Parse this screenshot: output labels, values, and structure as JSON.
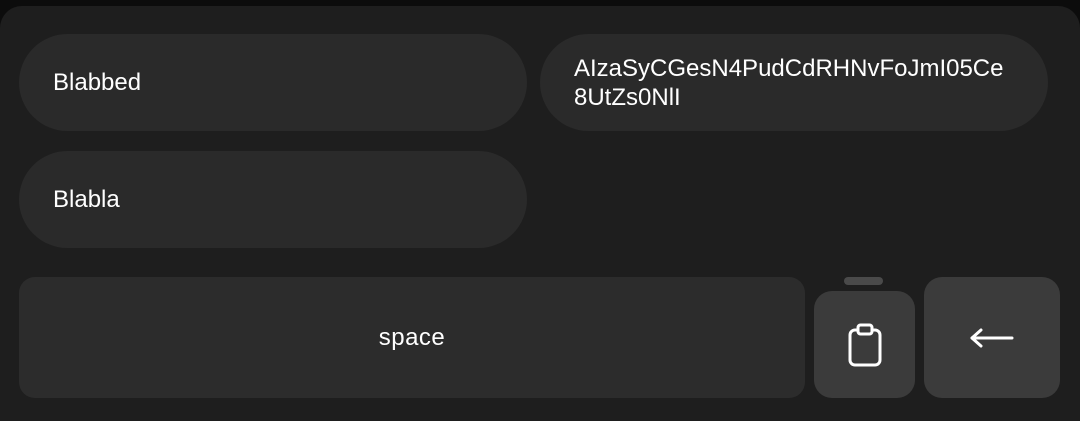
{
  "clipboard": {
    "items": [
      {
        "text": "Blabbed"
      },
      {
        "text": "AIzaSyCGesN4PudCdRHNvFoJmI05Ce8UtZs0NlI"
      },
      {
        "text": "Blabla"
      }
    ]
  },
  "keyboard": {
    "space_label": "space",
    "clipboard_icon": "clipboard-icon",
    "backspace_icon": "backspace-arrow-icon"
  },
  "colors": {
    "background": "#1e1e1e",
    "chip": "#2a2a2a",
    "key": "#2c2c2c",
    "key_accent": "#3b3b3b",
    "text": "#ffffff"
  }
}
